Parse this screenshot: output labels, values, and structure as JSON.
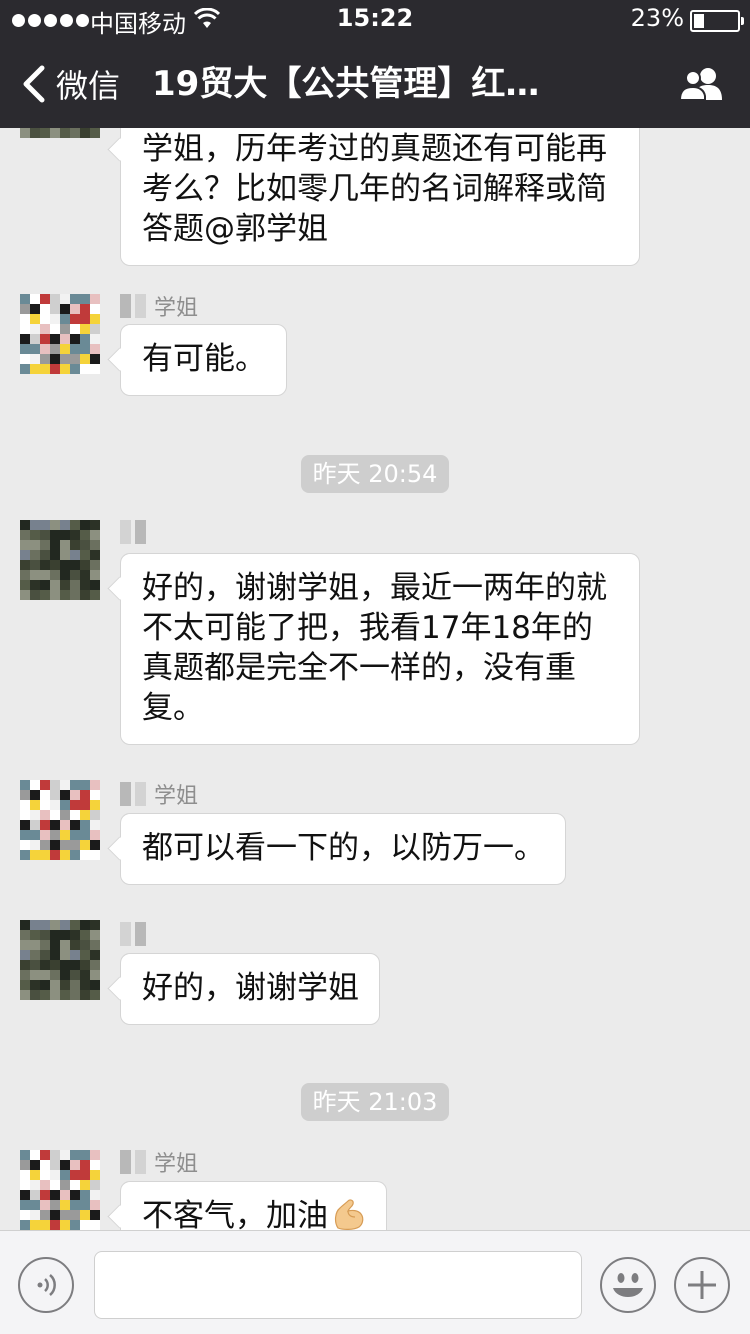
{
  "status_bar": {
    "carrier": "中国移动",
    "time": "15:22",
    "battery_percent": "23%",
    "battery_level": 0.23
  },
  "nav": {
    "back_label": "微信",
    "title": "19贸大【公共管理】红…",
    "icons": {
      "back": "chevron-left-icon",
      "group": "group-info-icon"
    }
  },
  "messages": [
    {
      "type": "text",
      "sender": "",
      "text": "学姐，历年考过的真题还有可能再考么？比如零几年的名词解释或简答题@郭学姐",
      "lines": [
        "学姐，历年考过的真题还有可能再",
        "考么？比如零几年的名词解释或简",
        "答题@郭学姐"
      ],
      "avatar": "student"
    },
    {
      "type": "text",
      "sender": "学姐",
      "text": "有可能。",
      "lines": [
        "有可能。"
      ],
      "avatar": "senior"
    },
    {
      "type": "time",
      "text": "昨天 20:54"
    },
    {
      "type": "text",
      "sender": "",
      "text": "好的，谢谢学姐，最近一两年的就不太可能了把，我看17年18年的真题都是完全不一样的，没有重复。",
      "lines": [
        "好的，谢谢学姐，最近一两年的就",
        "不太可能了把，我看17年18年的",
        "真题都是完全不一样的，没有重",
        "复。"
      ],
      "avatar": "student"
    },
    {
      "type": "text",
      "sender": "学姐",
      "text": "都可以看一下的，以防万一。",
      "lines": [
        "都可以看一下的，以防万一。"
      ],
      "avatar": "senior"
    },
    {
      "type": "text",
      "sender": "",
      "text": "好的，谢谢学姐",
      "lines": [
        "好的，谢谢学姐"
      ],
      "avatar": "student"
    },
    {
      "type": "time",
      "text": "昨天 21:03"
    },
    {
      "type": "text",
      "sender": "学姐",
      "text": "不客气，加油",
      "lines": [
        "不客气，加油"
      ],
      "emoji": "flexed-biceps-icon",
      "avatar": "senior"
    }
  ],
  "input_bar": {
    "placeholder": "",
    "value": "",
    "icons": {
      "voice": "voice-input-icon",
      "emoji": "emoji-icon",
      "more": "plus-icon"
    }
  }
}
